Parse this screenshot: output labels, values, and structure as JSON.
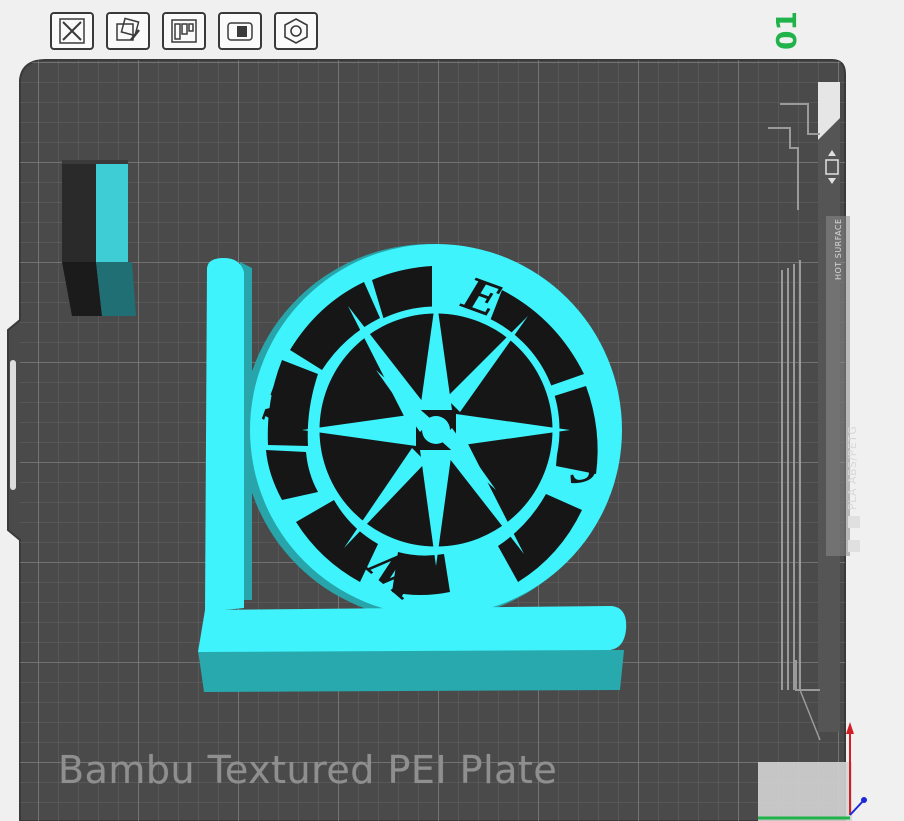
{
  "toolbar": {
    "buttons": [
      {
        "name": "close-view-button",
        "icon": "close-icon"
      },
      {
        "name": "auto-orient-button",
        "icon": "auto-orient-icon"
      },
      {
        "name": "arrange-button",
        "icon": "arrange-icon"
      },
      {
        "name": "lock-button",
        "icon": "lock-icon"
      },
      {
        "name": "plate-settings-button",
        "icon": "hexagon-icon"
      }
    ]
  },
  "plate": {
    "number": "01",
    "label": "Bambu Textured PEI Plate",
    "side_label_top": "HOT SURFACE",
    "side_label_bottom": "PLA ABS/PETG"
  },
  "model": {
    "letters": {
      "north": "N",
      "east": "E",
      "south": "S",
      "west": "W"
    }
  },
  "colors": {
    "background": "#f0f0f0",
    "plate": "#4a4a4a",
    "grid": "#6a6a6a",
    "grid_major": "#7d7d7d",
    "model_top": "#3ef3fb",
    "model_side": "#27a8ad",
    "cutout": "#161616",
    "axis_x": "#1fb34a",
    "axis_y": "#d21f26",
    "axis_z": "#1b2ad6"
  }
}
